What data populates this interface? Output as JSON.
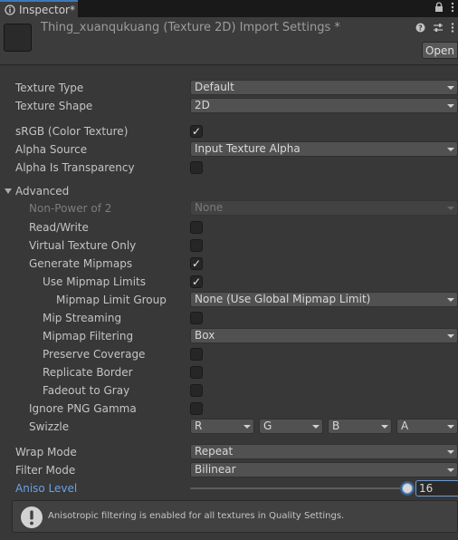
{
  "tab": {
    "label": "Inspector*"
  },
  "header": {
    "title": "Thing_xuanqukuang (Texture 2D) Import Settings *",
    "open_button": "Open"
  },
  "settings": {
    "texture_type": {
      "label": "Texture Type",
      "value": "Default"
    },
    "texture_shape": {
      "label": "Texture Shape",
      "value": "2D"
    },
    "srgb": {
      "label": "sRGB (Color Texture)",
      "checked": true
    },
    "alpha_source": {
      "label": "Alpha Source",
      "value": "Input Texture Alpha"
    },
    "alpha_is_transparency": {
      "label": "Alpha Is Transparency",
      "checked": false
    },
    "advanced": {
      "label": "Advanced",
      "non_power_of_2": {
        "label": "Non-Power of 2",
        "value": "None"
      },
      "read_write": {
        "label": "Read/Write",
        "checked": false
      },
      "virtual_texture_only": {
        "label": "Virtual Texture Only",
        "checked": false
      },
      "generate_mipmaps": {
        "label": "Generate Mipmaps",
        "checked": true
      },
      "use_mipmap_limits": {
        "label": "Use Mipmap Limits",
        "checked": true
      },
      "mipmap_limit_group": {
        "label": "Mipmap Limit Group",
        "value": "None (Use Global Mipmap Limit)"
      },
      "mip_streaming": {
        "label": "Mip Streaming",
        "checked": false
      },
      "mipmap_filtering": {
        "label": "Mipmap Filtering",
        "value": "Box"
      },
      "preserve_coverage": {
        "label": "Preserve Coverage",
        "checked": false
      },
      "replicate_border": {
        "label": "Replicate Border",
        "checked": false
      },
      "fadeout_to_gray": {
        "label": "Fadeout to Gray",
        "checked": false
      },
      "ignore_png_gamma": {
        "label": "Ignore PNG Gamma",
        "checked": false
      },
      "swizzle": {
        "label": "Swizzle",
        "r": "R",
        "g": "G",
        "b": "B",
        "a": "A"
      }
    },
    "wrap_mode": {
      "label": "Wrap Mode",
      "value": "Repeat"
    },
    "filter_mode": {
      "label": "Filter Mode",
      "value": "Bilinear"
    },
    "aniso_level": {
      "label": "Aniso Level",
      "value": "16",
      "fraction": 1.0
    }
  },
  "help_box": {
    "text": "Anisotropic filtering is enabled for all textures in Quality Settings."
  },
  "colors": {
    "accent": "#3a79bb",
    "background": "#383838",
    "label_highlight": "#6aa0e6"
  }
}
